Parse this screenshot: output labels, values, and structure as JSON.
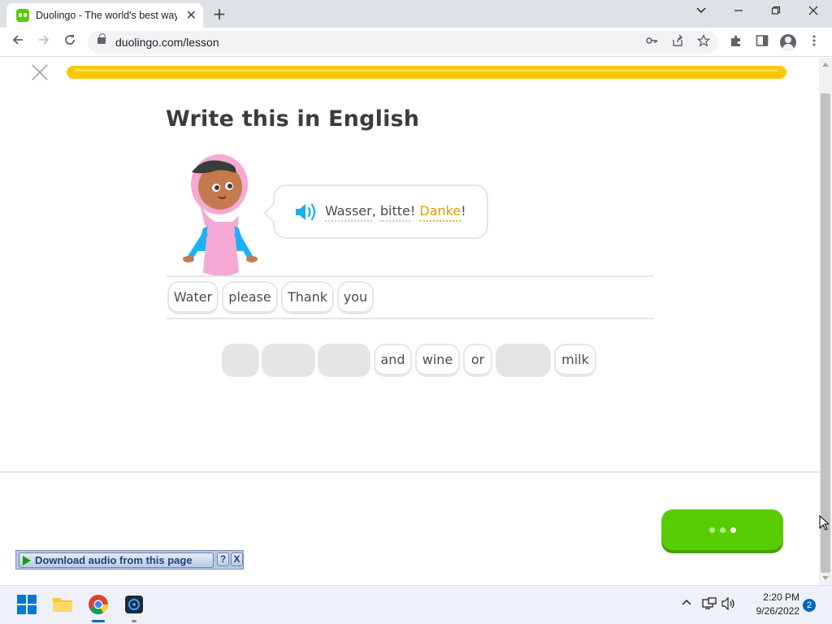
{
  "browser": {
    "tab_title": "Duolingo - The world's best way",
    "url": "duolingo.com/lesson",
    "tab_close_glyph": "✕",
    "new_tab_glyph": "+"
  },
  "lesson": {
    "progress_fraction": 1.0,
    "heading": "Write this in English",
    "prompt_words": [
      "Wasser",
      "bitte",
      "Danke"
    ],
    "prompt_new_word": "Danke",
    "selected_words": [
      "Water",
      "please",
      "Thank",
      "you"
    ],
    "bank_words": [
      "and",
      "wine",
      "or",
      "milk"
    ],
    "bank_empty_slots": 4
  },
  "download_bar": {
    "label": "Download audio from this page",
    "help": "?",
    "close": "X"
  },
  "taskbar": {
    "time": "2:20 PM",
    "date": "9/26/2022",
    "notification_count": "2"
  },
  "colors": {
    "brand_green": "#58cc02",
    "progress_yellow": "#ffc800",
    "new_word_orange": "#e89a00",
    "speaker_blue": "#1cb0f6"
  },
  "icons": [
    "duolingo-favicon",
    "back-arrow-icon",
    "forward-arrow-icon",
    "reload-icon",
    "lock-icon",
    "key-icon",
    "share-icon",
    "star-icon",
    "extensions-icon",
    "side-panel-icon",
    "profile-icon",
    "menu-icon",
    "close-icon",
    "speaker-icon",
    "windows-start-icon",
    "file-explorer-icon",
    "chrome-icon",
    "app-icon"
  ]
}
